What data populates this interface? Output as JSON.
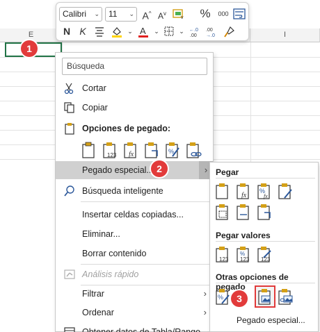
{
  "sheet": {
    "columns": [
      {
        "label": "E"
      },
      {
        "label": "I"
      }
    ]
  },
  "mini_toolbar": {
    "font_name": "Calibri",
    "font_size": "11",
    "bold": "N",
    "italic": "K",
    "percent": "%",
    "thousands": "000",
    "icons": [
      "increase-font-size-icon",
      "decrease-font-size-icon",
      "accounting-format-icon",
      "percent-icon",
      "thousands-separator-icon",
      "wrap-text-icon",
      "align-icon",
      "fill-color-icon",
      "font-color-icon",
      "borders-icon",
      "increase-decimal-icon",
      "decrease-decimal-icon",
      "format-painter-icon"
    ],
    "colors": {
      "fill": "#ffd400",
      "font": "#e0201f"
    }
  },
  "context_menu": {
    "search_placeholder": "Búsqueda",
    "cut": "Cortar",
    "copy": "Copiar",
    "paste_options_header": "Opciones de pegado:",
    "paste_special": "Pegado especial...",
    "smart_lookup": "Búsqueda inteligente",
    "insert_copied_cells": "Insertar celdas copiadas...",
    "delete": "Eliminar...",
    "clear_contents": "Borrar contenido",
    "quick_analysis": "Análisis rápido",
    "filter": "Filtrar",
    "sort": "Ordenar",
    "get_data": "Obtener datos de Tabla/Rango..."
  },
  "submenu": {
    "paste_header": "Pegar",
    "paste_values_header": "Pegar valores",
    "other_paste_options_header": "Otras opciones de pegado",
    "paste_special_link": "Pegado especial..."
  },
  "badges": {
    "one": "1",
    "two": "2",
    "three": "3"
  },
  "accent_colors": {
    "selection": "#217346",
    "badge": "#e23b3b"
  }
}
